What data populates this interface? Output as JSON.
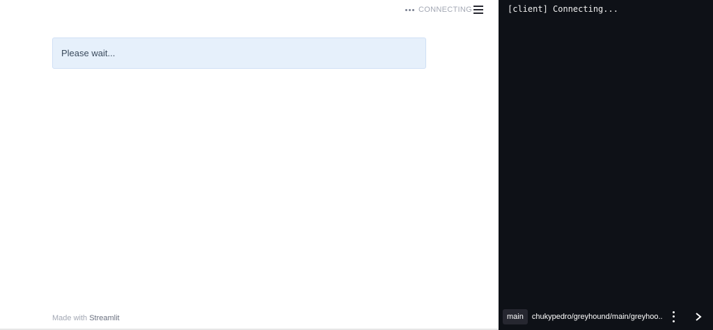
{
  "header": {
    "status_text": "CONNECTING",
    "status_icon": "ellipsis-icon",
    "menu_icon": "hamburger-menu-icon"
  },
  "main": {
    "alert_text": "Please wait..."
  },
  "footer": {
    "made_with": "Made with ",
    "brand": "Streamlit"
  },
  "terminal": {
    "log_line": "[client] Connecting...",
    "branch": "main",
    "repo_path": "chukypedro/greyhound/main/greyhoo...",
    "more_icon": "kebab-menu-icon",
    "collapse_icon": "chevron-right-icon"
  },
  "colors": {
    "terminal_bg": "#0e1117",
    "alert_bg": "#e6f0fb",
    "status_text": "#a3a8b4"
  }
}
